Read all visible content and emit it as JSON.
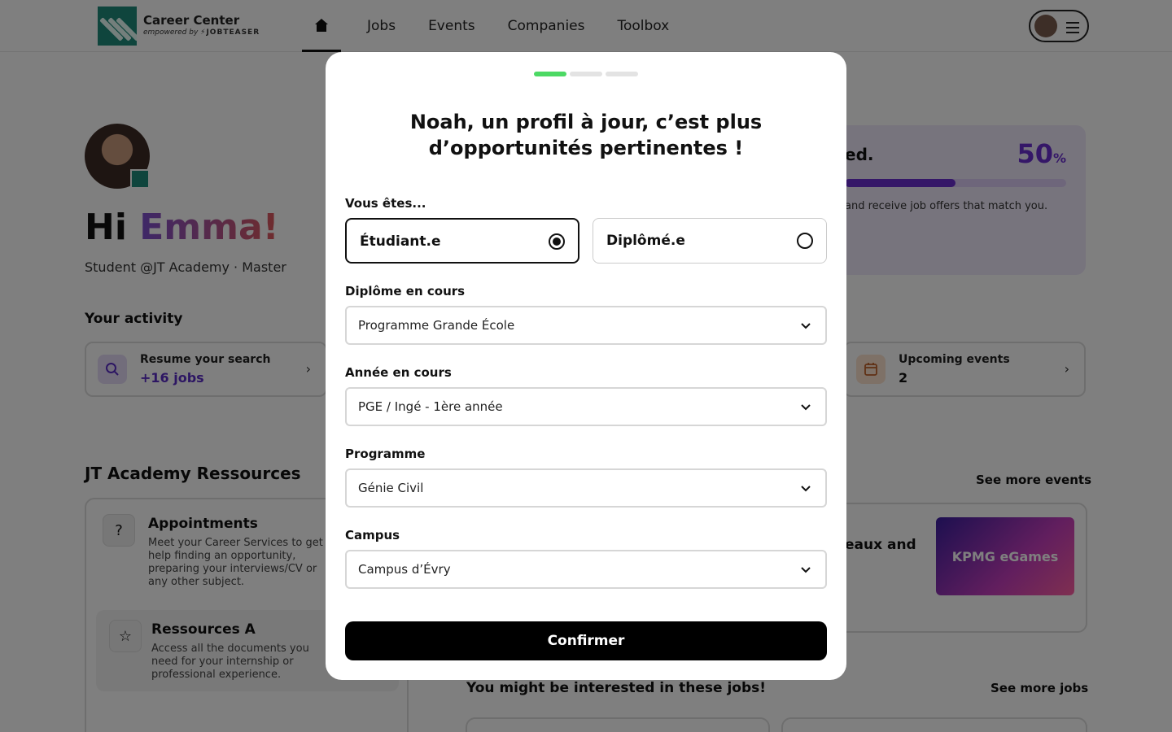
{
  "header": {
    "logo_title": "Career Center",
    "logo_sub_prefix": "empowered by ",
    "logo_sub_brand": "⚡JOBTEASER",
    "nav": [
      "Jobs",
      "Events",
      "Companies",
      "Toolbox"
    ]
  },
  "profile": {
    "greeting": "Hi ",
    "name": "Emma!",
    "subtitle": "Student @JT Academy  ·  Master"
  },
  "progress": {
    "title_fragment": "ed.",
    "percent": "50",
    "percent_sign": "%",
    "value": 0.5,
    "description_fragment": "and receive job offers that match you."
  },
  "activity": {
    "title": "Your activity",
    "cards": [
      {
        "title": "Resume your search",
        "value": "+16 jobs",
        "value_color": "#5a2dc7",
        "icon": "search-icon"
      },
      {
        "title": "Upcoming events",
        "value": "2",
        "value_color": "#111111",
        "icon": "calendar-icon"
      }
    ]
  },
  "resources": {
    "title": "JT Academy Ressources",
    "items": [
      {
        "title": "Appointments",
        "desc": "Meet your Career Services to get help finding an opportunity, preparing your interviews/CV or any other subject.",
        "icon": "question-icon"
      },
      {
        "title": "Ressources A",
        "desc": "Access all the documents you need for your internship or professional experience.",
        "icon": "folder-star-icon"
      }
    ]
  },
  "events": {
    "see_more": "See more events",
    "card_fragment": "eaux and",
    "thumb_text": "KPMG eGames"
  },
  "jobs": {
    "title": "You might be interested in these jobs!",
    "see_more": "See more jobs"
  },
  "modal": {
    "title": "Noah, un profil à jour, c’est plus d’opportunités pertinentes !",
    "status_label": "Vous êtes...",
    "options": [
      {
        "label": "Étudiant.e",
        "selected": true
      },
      {
        "label": "Diplômé.e",
        "selected": false
      }
    ],
    "fields": [
      {
        "label": "Diplôme en cours",
        "value": "Programme Grande École"
      },
      {
        "label": "Année en cours",
        "value": "PGE / Ingé - 1ère année"
      },
      {
        "label": "Programme",
        "value": "Génie Civil"
      },
      {
        "label": "Campus",
        "value": "Campus d’Évry"
      }
    ],
    "confirm_label": "Confirmer",
    "current_step": 1,
    "total_steps": 3
  },
  "colors": {
    "accent_green": "#4cd964",
    "brand_teal": "#1f8a7a",
    "purple": "#6a2fd1",
    "overlay": "rgba(0,0,0,0.5)"
  }
}
